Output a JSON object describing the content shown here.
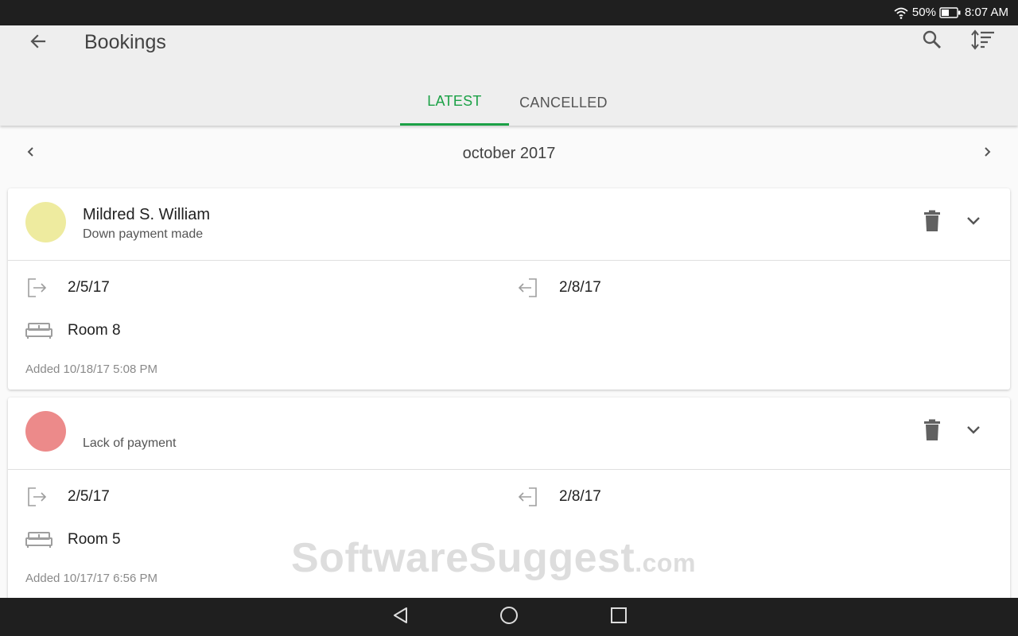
{
  "status_bar": {
    "battery": "50%",
    "time": "8:07 AM",
    "icons": [
      "wifi-icon",
      "battery-icon"
    ]
  },
  "app_bar": {
    "title": "Bookings",
    "icons": [
      "back-arrow-icon",
      "search-icon",
      "sort-icon"
    ],
    "tabs": [
      {
        "label": "LATEST",
        "active": true
      },
      {
        "label": "CANCELLED",
        "active": false
      }
    ]
  },
  "month_nav": {
    "label": "october 2017",
    "icons": [
      "chevron-left-icon",
      "chevron-right-icon"
    ]
  },
  "bookings": [
    {
      "guest_name": "Mildred S. William",
      "payment_status": "Down payment made",
      "avatar_color": "#eeeb9f",
      "check_in": "2/5/17",
      "check_out": "2/8/17",
      "room": "Room 8",
      "added": "Added 10/18/17  5:08 PM"
    },
    {
      "guest_name": "",
      "payment_status": "Lack of payment",
      "avatar_color": "#ec8a8a",
      "check_in": "2/5/17",
      "check_out": "2/8/17",
      "room": "Room 5",
      "added": "Added 10/17/17  6:56 PM"
    }
  ],
  "watermark": {
    "main": "SoftwareSuggest",
    "suffix": ".com"
  },
  "nav_bar": {
    "icons": [
      "nav-back-icon",
      "nav-home-icon",
      "nav-recents-icon"
    ]
  },
  "colors": {
    "accent": "#1ba146",
    "status_bar": "#1f1f1f",
    "app_bar": "#eeeeee"
  }
}
